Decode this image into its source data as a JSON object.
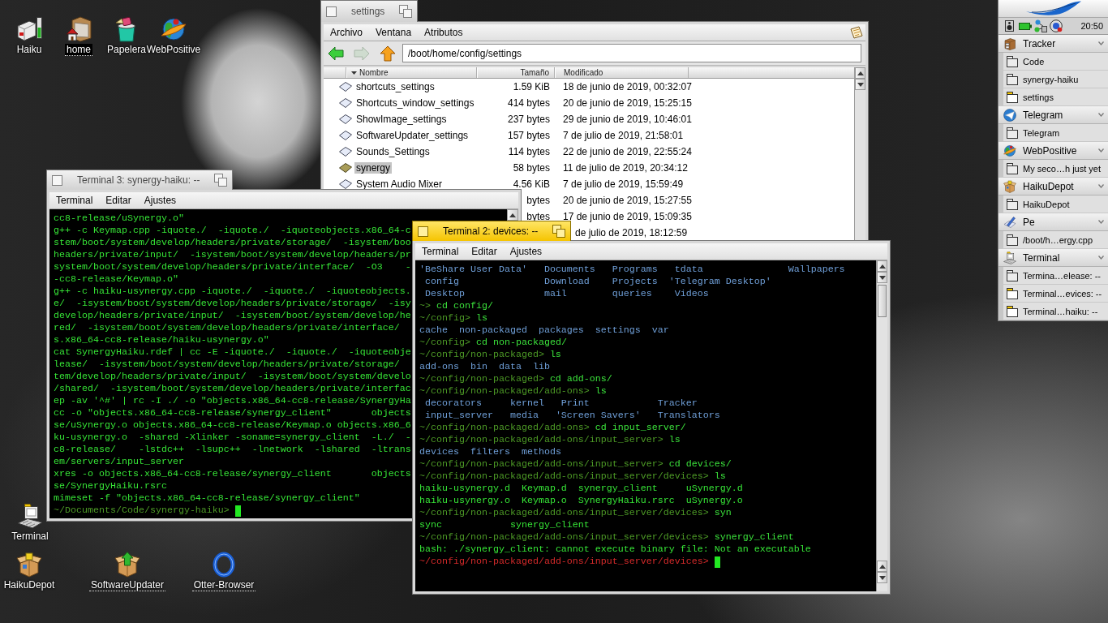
{
  "desktop_icons": [
    {
      "label": "Haiku",
      "selected": false,
      "link": false
    },
    {
      "label": "home",
      "selected": true,
      "link": true
    },
    {
      "label": "Papelera",
      "selected": false,
      "link": false
    },
    {
      "label": "WebPositive",
      "selected": false,
      "link": false
    },
    {
      "label": "Terminal",
      "selected": false,
      "link": false
    },
    {
      "label": "HaikuDepot",
      "selected": false,
      "link": false
    },
    {
      "label": "SoftwareUpdater",
      "selected": false,
      "link": true
    },
    {
      "label": "Otter-Browser",
      "selected": false,
      "link": true
    }
  ],
  "tracker_window": {
    "title": "settings",
    "active": false,
    "menu": [
      "Archivo",
      "Ventana",
      "Atributos"
    ],
    "toolbar": [
      {
        "kind": "back",
        "disabled": false
      },
      {
        "kind": "forward",
        "disabled": true
      },
      {
        "kind": "up",
        "disabled": false
      }
    ],
    "path": "/boot/home/config/settings",
    "columns": [
      {
        "label": "Nombre",
        "sorted": true
      },
      {
        "label": "Tamaño",
        "sorted": false
      },
      {
        "label": "Modificado",
        "sorted": false
      }
    ],
    "rows": [
      {
        "kind": "settings",
        "name": "shortcuts_settings",
        "selected": false,
        "size": "1.59 KiB",
        "modified": "18 de junio de 2019, 00:32:07"
      },
      {
        "kind": "settings",
        "name": "Shortcuts_window_settings",
        "selected": false,
        "size": "414 bytes",
        "modified": "20 de junio de 2019, 15:25:15"
      },
      {
        "kind": "settings",
        "name": "ShowImage_settings",
        "selected": false,
        "size": "237 bytes",
        "modified": "29 de junio de 2019, 10:46:01"
      },
      {
        "kind": "settings",
        "name": "SoftwareUpdater_settings",
        "selected": false,
        "size": "157 bytes",
        "modified": "7 de julio de 2019, 21:58:01"
      },
      {
        "kind": "settings",
        "name": "Sounds_Settings",
        "selected": false,
        "size": "114 bytes",
        "modified": "22 de junio de 2019, 22:55:24"
      },
      {
        "kind": "generic",
        "name": "synergy",
        "selected": true,
        "size": "58 bytes",
        "modified": "11 de julio de 2019, 20:34:12"
      },
      {
        "kind": "settings",
        "name": "System Audio Mixer",
        "selected": false,
        "size": "4.56 KiB",
        "modified": "7 de julio de 2019, 15:59:49"
      },
      {
        "selected": false,
        "size": "bytes",
        "modified": "20 de junio de 2019, 15:27:55"
      },
      {
        "selected": false,
        "size": "bytes",
        "modified": "17 de junio de 2019, 15:09:35"
      },
      {
        "selected": false,
        "modified": "de julio de 2019, 18:12:59"
      }
    ]
  },
  "terminal_windows": [
    {
      "title": "Terminal 3: synergy-haiku: --",
      "active": false,
      "menu": [
        "Terminal",
        "Editar",
        "Ajustes"
      ],
      "lines": [
        [
          {
            "kind": "output",
            "text": "cc8-release/uSynergy.o\""
          }
        ],
        [
          {
            "kind": "output",
            "text": "g++ -c Keymap.cpp -iquote./  -iquote./  -iquoteobjects.x86_64-c"
          }
        ],
        [
          {
            "kind": "output",
            "text": "stem/boot/system/develop/headers/private/storage/  -isystem/boo"
          }
        ],
        [
          {
            "kind": "output",
            "text": "headers/private/input/  -isystem/boot/system/develop/headers/pr"
          }
        ],
        [
          {
            "kind": "output",
            "text": "system/boot/system/develop/headers/private/interface/  -O3    -"
          }
        ],
        [
          {
            "kind": "output",
            "text": "-cc8-release/Keymap.o\""
          }
        ],
        [
          {
            "kind": "output",
            "text": "g++ -c haiku-usynergy.cpp -iquote./  -iquote./  -iquoteobjects."
          }
        ],
        [
          {
            "kind": "output",
            "text": "e/  -isystem/boot/system/develop/headers/private/storage/  -isy"
          }
        ],
        [
          {
            "kind": "output",
            "text": "develop/headers/private/input/  -isystem/boot/system/develop/he"
          }
        ],
        [
          {
            "kind": "output",
            "text": "red/  -isystem/boot/system/develop/headers/private/interface/"
          }
        ],
        [
          {
            "kind": "output",
            "text": "s.x86_64-cc8-release/haiku-usynergy.o\""
          }
        ],
        [
          {
            "kind": "output",
            "text": "cat SynergyHaiku.rdef | cc -E -iquote./  -iquote./  -iquoteobje"
          }
        ],
        [
          {
            "kind": "output",
            "text": "lease/  -isystem/boot/system/develop/headers/private/storage/"
          }
        ],
        [
          {
            "kind": "output",
            "text": "tem/develop/headers/private/input/  -isystem/boot/system/develo"
          }
        ],
        [
          {
            "kind": "output",
            "text": "/shared/  -isystem/boot/system/develop/headers/private/interfac"
          }
        ],
        [
          {
            "kind": "output",
            "text": "ep -av '^#' | rc -I ./ -o \"objects.x86_64-cc8-release/SynergyHa"
          }
        ],
        [
          {
            "kind": "output",
            "text": "cc -o \"objects.x86_64-cc8-release/synergy_client\"       objects"
          }
        ],
        [
          {
            "kind": "output",
            "text": "se/uSynergy.o objects.x86_64-cc8-release/Keymap.o objects.x86_6"
          }
        ],
        [
          {
            "kind": "output",
            "text": "ku-usynergy.o  -shared -Xlinker -soname=synergy_client  -L./  -"
          }
        ],
        [
          {
            "kind": "output",
            "text": "c8-release/    -lstdc++  -lsupc++  -lnetwork  -lshared  -ltrans"
          }
        ],
        [
          {
            "kind": "output",
            "text": "em/servers/input_server"
          }
        ],
        [
          {
            "kind": "output",
            "text": "xres -o objects.x86_64-cc8-release/synergy_client       objects"
          }
        ],
        [
          {
            "kind": "output",
            "text": "se/SynergyHaiku.rsrc"
          }
        ],
        [
          {
            "kind": "output",
            "text": "mimeset -f \"objects.x86_64-cc8-release/synergy_client\""
          }
        ],
        [
          {
            "kind": "prompt",
            "text": "~/Documents/Code/synergy-haiku>"
          },
          {
            "kind": "cursor"
          }
        ]
      ]
    },
    {
      "title": "Terminal 2: devices: --",
      "active": true,
      "menu": [
        "Terminal",
        "Editar",
        "Ajustes"
      ],
      "lines": [
        [
          {
            "kind": "dirs",
            "text": "'BeShare User Data'   Documents   Programs   tdata               Wallpapers"
          }
        ],
        [
          {
            "kind": "dirs",
            "text": " config               Download    Projects  'Telegram Desktop'"
          }
        ],
        [
          {
            "kind": "dirs",
            "text": " Desktop              mail        queries    Videos"
          }
        ],
        [
          {
            "kind": "prompt",
            "text": "~>"
          },
          {
            "kind": "command",
            "text": "cd config/"
          }
        ],
        [
          {
            "kind": "prompt",
            "text": "~/config>"
          },
          {
            "kind": "command",
            "text": "ls"
          }
        ],
        [
          {
            "kind": "dirs",
            "text": "cache  non-packaged  packages  settings  var"
          }
        ],
        [
          {
            "kind": "prompt",
            "text": "~/config>"
          },
          {
            "kind": "command",
            "text": "cd non-packaged/"
          }
        ],
        [
          {
            "kind": "prompt",
            "text": "~/config/non-packaged>"
          },
          {
            "kind": "command",
            "text": "ls"
          }
        ],
        [
          {
            "kind": "dirs",
            "text": "add-ons  bin  data  lib"
          }
        ],
        [
          {
            "kind": "prompt",
            "text": "~/config/non-packaged>"
          },
          {
            "kind": "command",
            "text": "cd add-ons/"
          }
        ],
        [
          {
            "kind": "prompt",
            "text": "~/config/non-packaged/add-ons>"
          },
          {
            "kind": "command",
            "text": "ls"
          }
        ],
        [
          {
            "kind": "dirs",
            "text": " decorators     kernel   Print            Tracker"
          }
        ],
        [
          {
            "kind": "dirs",
            "text": " input_server   media   'Screen Savers'   Translators"
          }
        ],
        [
          {
            "kind": "prompt",
            "text": "~/config/non-packaged/add-ons>"
          },
          {
            "kind": "command",
            "text": "cd input_server/"
          }
        ],
        [
          {
            "kind": "prompt",
            "text": "~/config/non-packaged/add-ons/input_server>"
          },
          {
            "kind": "command",
            "text": "ls"
          }
        ],
        [
          {
            "kind": "dirs",
            "text": "devices  filters  methods"
          }
        ],
        [
          {
            "kind": "prompt",
            "text": "~/config/non-packaged/add-ons/input_server>"
          },
          {
            "kind": "command",
            "text": "cd devices/"
          }
        ],
        [
          {
            "kind": "prompt",
            "text": "~/config/non-packaged/add-ons/input_server/devices>"
          },
          {
            "kind": "command",
            "text": "ls"
          }
        ],
        [
          {
            "kind": "output",
            "text": "haiku-usynergy.d  Keymap.d  synergy_client     uSynergy.d"
          }
        ],
        [
          {
            "kind": "output",
            "text": "haiku-usynergy.o  Keymap.o  SynergyHaiku.rsrc  uSynergy.o"
          }
        ],
        [
          {
            "kind": "prompt",
            "text": "~/config/non-packaged/add-ons/input_server/devices>"
          },
          {
            "kind": "command",
            "text": "syn"
          }
        ],
        [
          {
            "kind": "output",
            "text": "sync            synergy_client"
          }
        ],
        [
          {
            "kind": "prompt",
            "text": "~/config/non-packaged/add-ons/input_server/devices>"
          },
          {
            "kind": "command",
            "text": "synergy_client"
          }
        ],
        [
          {
            "kind": "output",
            "text": "bash: ./synergy_client: cannot execute binary file: Not an executable"
          }
        ],
        [
          {
            "kind": "prompt_failed",
            "text": "~/config/non-packaged/add-ons/input_server/devices>"
          },
          {
            "kind": "cursor"
          }
        ]
      ]
    }
  ],
  "deskbar": {
    "clock": "20:50",
    "apps": [
      {
        "name": "Tracker",
        "windows": [
          {
            "title": "Code",
            "shown": false
          },
          {
            "title": "synergy-haiku",
            "shown": false
          },
          {
            "title": "settings",
            "shown": true
          }
        ]
      },
      {
        "name": "Telegram",
        "windows": [
          {
            "title": "Telegram",
            "shown": false
          }
        ]
      },
      {
        "name": "WebPositive",
        "windows": [
          {
            "title": "My seco…h just yet",
            "shown": false
          }
        ]
      },
      {
        "name": "HaikuDepot",
        "windows": [
          {
            "title": "HaikuDepot",
            "shown": false
          }
        ]
      },
      {
        "name": "Pe",
        "windows": [
          {
            "title": "/boot/h…ergy.cpp",
            "shown": false
          }
        ]
      },
      {
        "name": "Terminal",
        "windows": [
          {
            "title": "Termina…elease: --",
            "shown": false
          },
          {
            "title": "Terminal…evices: --",
            "shown": true
          },
          {
            "title": "Terminal…haiku: --",
            "shown": true
          }
        ]
      }
    ]
  }
}
